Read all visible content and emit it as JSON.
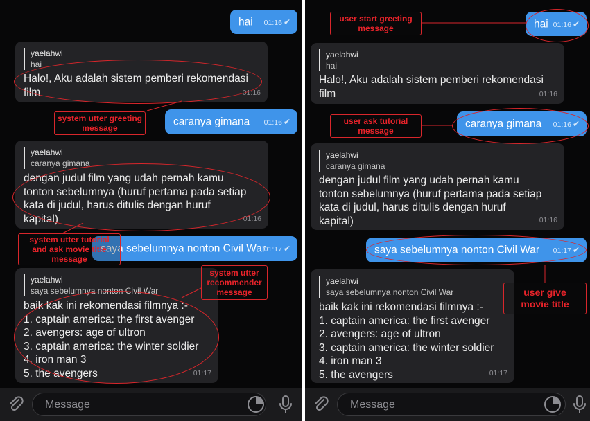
{
  "left": {
    "messages": {
      "hai": {
        "text": "hai",
        "time": "01:16"
      },
      "greet": {
        "reply_name": "yaelahwi",
        "reply_text": "hai",
        "body": "Halo!, Aku adalah sistem pemberi rekomendasi\nfilm",
        "time": "01:16"
      },
      "caranya": {
        "text": "caranya gimana",
        "time": "01:16"
      },
      "tutorial": {
        "reply_name": "yaelahwi",
        "reply_text": "caranya gimana",
        "body": "dengan judul film yang udah pernah kamu\ntonton sebelumnya (huruf pertama pada setiap\nkata di judul, harus ditulis dengan huruf\nkapital)",
        "time": "01:16"
      },
      "saya": {
        "text": "saya sebelumnya nonton Civil War",
        "time": "01:17"
      },
      "rekom": {
        "reply_name": "yaelahwi",
        "reply_text": "saya sebelumnya nonton Civil War",
        "body": "baik kak ini rekomendasi filmnya :-\n1. captain america: the first avenger\n2. avengers: age of ultron\n3. captain america: the winter soldier\n4. iron man 3\n5. the avengers",
        "time": "01:17"
      }
    },
    "annotations": {
      "system_greeting": "system utter greeting\nmessage",
      "system_tutorial": "system utter tutorial\nand ask movie title\nmessage",
      "system_recommender": "system utter\nrecommender\nmessage"
    },
    "input_placeholder": "Message"
  },
  "right": {
    "messages": {
      "hai": {
        "text": "hai",
        "time": "01:16"
      },
      "greet": {
        "reply_name": "yaelahwi",
        "reply_text": "hai",
        "body": "Halo!, Aku adalah sistem pemberi rekomendasi\nfilm",
        "time": "01:16"
      },
      "caranya": {
        "text": "caranya gimana",
        "time": "01:16"
      },
      "tutorial": {
        "reply_name": "yaelahwi",
        "reply_text": "caranya gimana",
        "body": "dengan judul film yang udah pernah kamu\ntonton sebelumnya (huruf pertama pada setiap\nkata di judul, harus ditulis dengan huruf\nkapital)",
        "time": "01:16"
      },
      "saya": {
        "text": "saya sebelumnya nonton Civil War",
        "time": "01:17"
      },
      "rekom": {
        "reply_name": "yaelahwi",
        "reply_text": "saya sebelumnya nonton Civil War",
        "body": "baik kak ini rekomendasi filmnya :-\n1. captain america: the first avenger\n2. avengers: age of ultron\n3. captain america: the winter soldier\n4. iron man 3\n5. the avengers",
        "time": "01:17"
      }
    },
    "annotations": {
      "user_greeting": "user start greeting\nmessage",
      "user_tutorial": "user ask tutorial\nmessage",
      "user_movie": "user give\nmovie title"
    },
    "input_placeholder": "Message"
  },
  "colors": {
    "outgoing_bubble": "#3f94ea",
    "incoming_bubble": "#232326",
    "background": "#070708",
    "annotation": "#d8262b"
  },
  "icons": [
    "paperclip-icon",
    "sticker-icon",
    "microphone-icon",
    "double-check-icon"
  ]
}
